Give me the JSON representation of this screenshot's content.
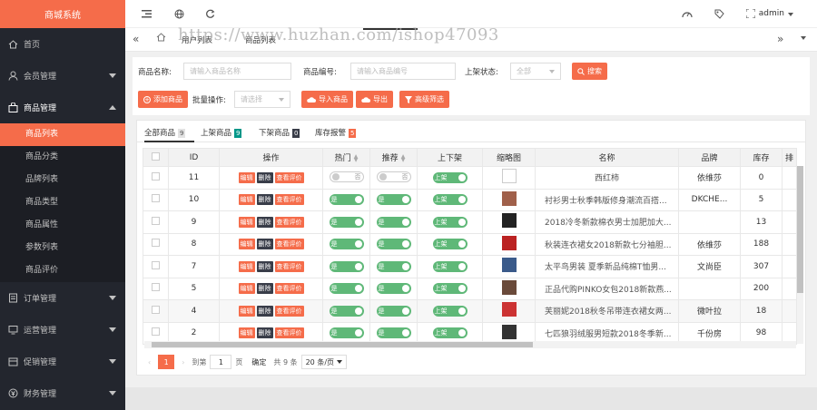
{
  "logo": "商城系统",
  "sidebar": {
    "items": [
      {
        "label": "首页",
        "icon": "home-icon"
      },
      {
        "label": "会员管理",
        "icon": "user-icon"
      },
      {
        "label": "商品管理",
        "icon": "bag-icon"
      },
      {
        "label": "订单管理",
        "icon": "order-icon"
      },
      {
        "label": "运营管理",
        "icon": "monitor-icon"
      },
      {
        "label": "促销管理",
        "icon": "promo-icon"
      },
      {
        "label": "财务管理",
        "icon": "finance-icon"
      }
    ],
    "sub": [
      "商品列表",
      "商品分类",
      "品牌列表",
      "商品类型",
      "商品属性",
      "参数列表",
      "商品评价"
    ]
  },
  "topbar": {
    "user": "admin"
  },
  "tabs": [
    "用户列表",
    "商品列表"
  ],
  "watermark": "https://www.huzhan.com/ishop47093",
  "filter": {
    "name_label": "商品名称:",
    "name_ph": "请输入商品名称",
    "code_label": "商品编号:",
    "code_ph": "请输入商品编号",
    "status_label": "上架状态:",
    "status_val": "全部",
    "search_btn": "搜索",
    "add_btn": "添加商品",
    "batch_label": "批量操作:",
    "batch_val": "请选择",
    "import_btn": "导入商品",
    "export_btn": "导出",
    "adv_btn": "高级筛选"
  },
  "ptabs": [
    {
      "label": "全部商品",
      "count": "9",
      "color": "#e2e2e2",
      "tc": "#555"
    },
    {
      "label": "上架商品",
      "count": "9",
      "color": "#009688",
      "tc": "#fff"
    },
    {
      "label": "下架商品",
      "count": "0",
      "color": "#393d49",
      "tc": "#fff"
    },
    {
      "label": "库存报警",
      "count": "5",
      "color": "#f56c4a",
      "tc": "#fff"
    }
  ],
  "headers": [
    "ID",
    "操作",
    "热门",
    "推荐",
    "上下架",
    "缩略图",
    "名称",
    "品牌",
    "库存",
    "排"
  ],
  "ops": [
    "编辑",
    "删除",
    "查看评价"
  ],
  "rows": [
    {
      "id": "11",
      "hot": "否",
      "hot_on": false,
      "rec": "否",
      "rec_on": false,
      "shelf": "上架",
      "name": "西红柿",
      "brand": "依维莎",
      "stock": "0"
    },
    {
      "id": "10",
      "hot": "是",
      "hot_on": true,
      "rec": "是",
      "rec_on": true,
      "shelf": "上架",
      "name": "衬衫男士秋季韩版修身潮流百搭...",
      "brand": "DKCHE...",
      "stock": "5"
    },
    {
      "id": "9",
      "hot": "是",
      "hot_on": true,
      "rec": "是",
      "rec_on": true,
      "shelf": "上架",
      "name": "2018冷冬新款棉衣男士加肥加大...",
      "brand": "",
      "stock": "13"
    },
    {
      "id": "8",
      "hot": "是",
      "hot_on": true,
      "rec": "是",
      "rec_on": true,
      "shelf": "上架",
      "name": "秋装连衣裙女2018新款七分袖胆...",
      "brand": "依维莎",
      "stock": "188"
    },
    {
      "id": "7",
      "hot": "是",
      "hot_on": true,
      "rec": "是",
      "rec_on": true,
      "shelf": "上架",
      "name": "太平鸟男装 夏季新品纯棉T恤男...",
      "brand": "文尚臣",
      "stock": "307"
    },
    {
      "id": "5",
      "hot": "是",
      "hot_on": true,
      "rec": "是",
      "rec_on": true,
      "shelf": "上架",
      "name": "正品代购PINKO女包2018新款燕...",
      "brand": "",
      "stock": "200"
    },
    {
      "id": "4",
      "hot": "是",
      "hot_on": true,
      "rec": "是",
      "rec_on": true,
      "shelf": "上架",
      "name": "芙丽妮2018秋冬吊带连衣裙女两...",
      "brand": "微叶拉",
      "stock": "18"
    },
    {
      "id": "2",
      "hot": "是",
      "hot_on": true,
      "rec": "是",
      "rec_on": true,
      "shelf": "上架",
      "name": "七匹狼羽绒服男短款2018冬季新...",
      "brand": "千份房",
      "stock": "98"
    }
  ],
  "pager": {
    "page": "1",
    "goto": "到第",
    "input": "1",
    "page_unit": "页",
    "confirm": "确定",
    "total": "共 9 条",
    "size": "20 条/页"
  }
}
